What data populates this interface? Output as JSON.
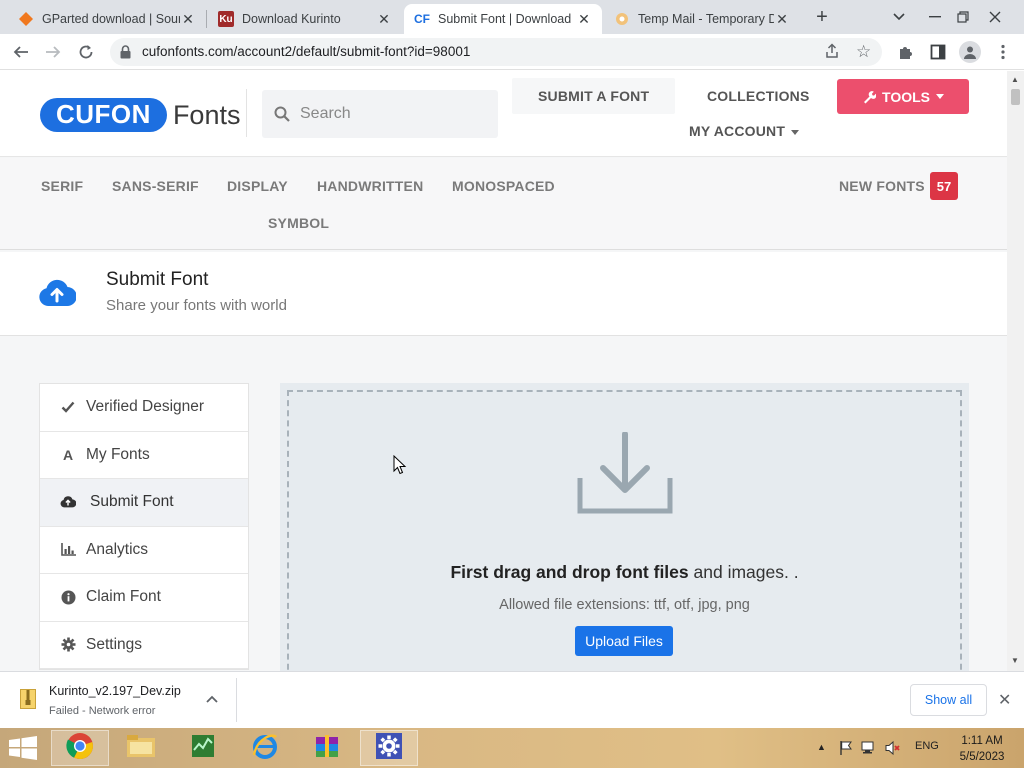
{
  "browser": {
    "tabs": [
      {
        "title": "GParted download | Sour",
        "icon": "gparted-icon"
      },
      {
        "title": "Download Kurinto",
        "icon": "kurinto-icon"
      },
      {
        "title": "Submit Font | Download",
        "icon": "cufon-icon",
        "active": true
      },
      {
        "title": "Temp Mail - Temporary D",
        "icon": "tempmail-icon"
      }
    ],
    "url": "cufonfonts.com/account2/default/submit-font?id=98001"
  },
  "site": {
    "logo_badge": "CUFON",
    "logo_text": "Fonts",
    "search_placeholder": "Search",
    "nav": {
      "submit": "SUBMIT A FONT",
      "collections": "COLLECTIONS",
      "account": "MY ACCOUNT",
      "tools": "TOOLS"
    },
    "categories": [
      "SERIF",
      "SANS-SERIF",
      "DISPLAY",
      "HANDWRITTEN",
      "MONOSPACED",
      "SYMBOL"
    ],
    "new_fonts_label": "NEW FONTS",
    "new_fonts_count": "57",
    "accent": "#1d6fe0",
    "tools_color": "#ec4f6d"
  },
  "page": {
    "title": "Submit Font",
    "subtitle": "Share your fonts with world"
  },
  "menu": [
    {
      "label": "Verified Designer",
      "icon": "check-icon"
    },
    {
      "label": "My Fonts",
      "icon": "font-icon"
    },
    {
      "label": "Submit Font",
      "icon": "cloud-upload-icon",
      "active": true
    },
    {
      "label": "Analytics",
      "icon": "bar-chart-icon"
    },
    {
      "label": "Claim Font",
      "icon": "info-icon"
    },
    {
      "label": "Settings",
      "icon": "gear-icon"
    }
  ],
  "dropzone": {
    "text_bold": "First drag and drop font files",
    "text_rest": " and images. .",
    "extensions": "Allowed file extensions: ttf, otf, jpg, png",
    "button": "Upload Files"
  },
  "download": {
    "filename": "Kurinto_v2.197_Dev.zip",
    "status": "Failed - Network error",
    "show_all": "Show all"
  },
  "taskbar": {
    "lang": "ENG",
    "time": "1:11 AM",
    "date": "5/5/2023"
  }
}
